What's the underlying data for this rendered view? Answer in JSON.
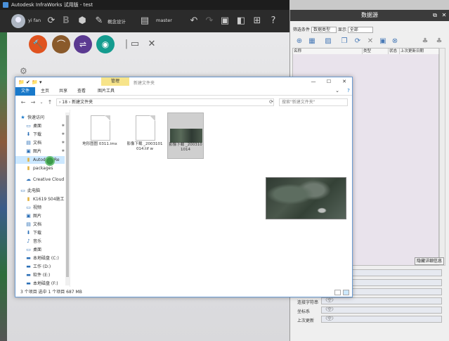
{
  "app": {
    "title": "Autodesk InfraWorks 试用版 - test",
    "user_name": "yi fan",
    "toolbar_label_1": "概念设计",
    "toolbar_label_2": "master"
  },
  "data_source_panel": {
    "title": "数据源",
    "group_label": "数据源",
    "group_select": "数据源",
    "filter_label": "筛选条件",
    "filter_select": "数据类型",
    "show_label": "显示",
    "show_select": "全部",
    "columns": [
      "名称",
      "类型",
      "状态",
      "上次更新日期"
    ],
    "detail_button": "隐藏详细信息",
    "properties": [
      {
        "label": "",
        "value": ""
      },
      {
        "label": "",
        "value": ""
      },
      {
        "label": "类型",
        "value": "〈空〉"
      },
      {
        "label": "连接字符串",
        "value": "〈空〉"
      },
      {
        "label": "坐标系",
        "value": "〈空〉"
      },
      {
        "label": "上次更新",
        "value": "〈空〉"
      }
    ]
  },
  "explorer": {
    "quick_access_icons": "📁 ✔ 📁 ▾",
    "context_tab": "管理",
    "title": "新建文件夹",
    "ribbon_tabs": [
      "文件",
      "主页",
      "共享",
      "查看",
      "图片工具"
    ],
    "address": "› 18 › 新建文件夹",
    "search_placeholder": "搜索\"新建文件夹\"",
    "nav": [
      {
        "icon": "★",
        "label": "快速访问",
        "pin": ""
      },
      {
        "icon": "▭",
        "label": "桌面",
        "pin": "✱"
      },
      {
        "icon": "⬇",
        "label": "下载",
        "pin": "✱"
      },
      {
        "icon": "▤",
        "label": "文档",
        "pin": "✱"
      },
      {
        "icon": "▣",
        "label": "图片",
        "pin": "✱"
      },
      {
        "icon": "▮",
        "label": "Autodesk Re",
        "pin": ""
      },
      {
        "icon": "▮",
        "label": "packages",
        "pin": ""
      },
      {
        "icon": "☁",
        "label": "Creative Cloud F",
        "pin": ""
      },
      {
        "icon": "▭",
        "label": "此电脑",
        "pin": ""
      },
      {
        "icon": "▮",
        "label": "K1619 S04施工",
        "pin": ""
      },
      {
        "icon": "▭",
        "label": "视频",
        "pin": ""
      },
      {
        "icon": "▣",
        "label": "图片",
        "pin": ""
      },
      {
        "icon": "▤",
        "label": "文档",
        "pin": ""
      },
      {
        "icon": "⬇",
        "label": "下载",
        "pin": ""
      },
      {
        "icon": "♪",
        "label": "音乐",
        "pin": ""
      },
      {
        "icon": "▭",
        "label": "桌面",
        "pin": ""
      },
      {
        "icon": "▬",
        "label": "本地磁盘 (C:)",
        "pin": ""
      },
      {
        "icon": "▬",
        "label": "工作 (D:)",
        "pin": ""
      },
      {
        "icon": "▬",
        "label": "软件 (E:)",
        "pin": ""
      },
      {
        "icon": "▬",
        "label": "本地磁盘 (F:)",
        "pin": ""
      }
    ],
    "files": [
      {
        "name": "地形图图 0311.imx",
        "type": "document"
      },
      {
        "name": "影像下载 _2003101014.tif w",
        "type": "document"
      },
      {
        "name": "影像下载 _2003101014",
        "type": "image"
      }
    ],
    "status": "3 个项目    选中 1 个项目  687 MB"
  },
  "colors": {
    "accent": "#1979ca",
    "context_tab": "#f7e48a",
    "tool_orange": "#e0531f",
    "tool_brown": "#8a5a2b",
    "tool_purple": "#5b3a91",
    "tool_teal": "#149c8f"
  }
}
